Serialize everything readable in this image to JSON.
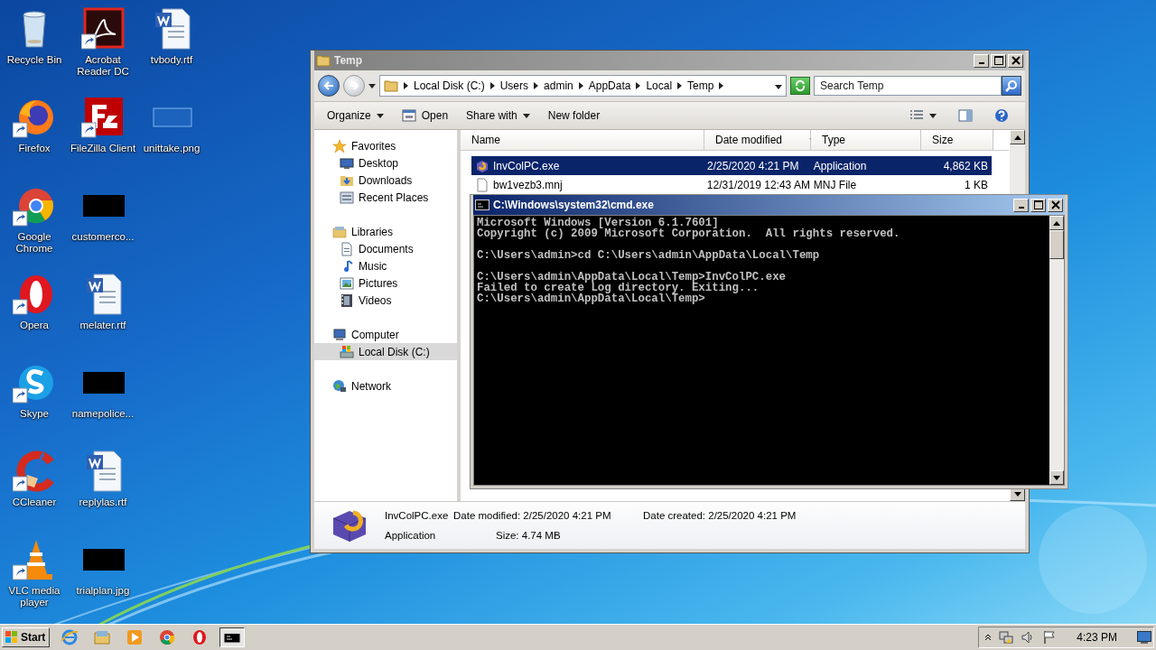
{
  "desktop": {
    "columns": [
      [
        {
          "label": "Recycle Bin",
          "kind": "recycle",
          "shortcut": false
        },
        {
          "label": "Firefox",
          "kind": "firefox",
          "shortcut": true
        },
        {
          "label": "Google Chrome",
          "kind": "chrome",
          "shortcut": true
        },
        {
          "label": "Opera",
          "kind": "opera",
          "shortcut": true
        },
        {
          "label": "Skype",
          "kind": "skype",
          "shortcut": true
        },
        {
          "label": "CCleaner",
          "kind": "ccleaner",
          "shortcut": true
        },
        {
          "label": "VLC media player",
          "kind": "vlc",
          "shortcut": true
        }
      ],
      [
        {
          "label": "Acrobat Reader DC",
          "kind": "acrobat",
          "shortcut": true
        },
        {
          "label": "FileZilla Client",
          "kind": "filezilla",
          "shortcut": true
        },
        {
          "label": "customerco...",
          "kind": "thumb",
          "shortcut": false
        },
        {
          "label": "melater.rtf",
          "kind": "word",
          "shortcut": false
        },
        {
          "label": "namepolice...",
          "kind": "thumb",
          "shortcut": false
        },
        {
          "label": "replylas.rtf",
          "kind": "word",
          "shortcut": false
        },
        {
          "label": "trialplan.jpg",
          "kind": "thumb",
          "shortcut": false
        }
      ],
      [
        {
          "label": "tvbody.rtf",
          "kind": "word",
          "shortcut": false
        },
        {
          "label": "unittake.png",
          "kind": "blank",
          "shortcut": false
        }
      ]
    ]
  },
  "explorer": {
    "title": "Temp",
    "active": false,
    "breadcrumb": [
      "Local Disk (C:)",
      "Users",
      "admin",
      "AppData",
      "Local",
      "Temp"
    ],
    "search": {
      "placeholder": "Search Temp"
    },
    "toolbar": [
      {
        "label": "Organize",
        "kind": "menu"
      },
      {
        "label": "Open",
        "kind": "open"
      },
      {
        "label": "Share with",
        "kind": "menu"
      },
      {
        "label": "New folder",
        "kind": "plain"
      }
    ],
    "nav": [
      {
        "label": "Favorites",
        "kind": "star",
        "selected": false,
        "children": [
          {
            "label": "Desktop",
            "kind": "desktop",
            "selected": false
          },
          {
            "label": "Downloads",
            "kind": "downloads",
            "selected": false
          },
          {
            "label": "Recent Places",
            "kind": "recent",
            "selected": false
          }
        ]
      },
      {
        "label": "Libraries",
        "kind": "library",
        "selected": false,
        "children": [
          {
            "label": "Documents",
            "kind": "documents",
            "selected": false
          },
          {
            "label": "Music",
            "kind": "music",
            "selected": false
          },
          {
            "label": "Pictures",
            "kind": "pictures",
            "selected": false
          },
          {
            "label": "Videos",
            "kind": "videos",
            "selected": false
          }
        ]
      },
      {
        "label": "Computer",
        "kind": "computer",
        "selected": false,
        "children": [
          {
            "label": "Local Disk (C:)",
            "kind": "drive",
            "selected": true
          }
        ]
      },
      {
        "label": "Network",
        "kind": "network",
        "selected": false
      }
    ],
    "columns": [
      {
        "label": "Name",
        "sorted": false
      },
      {
        "label": "Date modified",
        "sorted": true
      },
      {
        "label": "Type",
        "sorted": false
      },
      {
        "label": "Size",
        "sorted": false
      }
    ],
    "rows": [
      {
        "name": "InvColPC.exe",
        "kind": "exe",
        "date": "2/25/2020 4:21 PM",
        "type": "Application",
        "size": "4,862 KB",
        "selected": true
      },
      {
        "name": "bw1vezb3.mnj",
        "kind": "file",
        "date": "12/31/2019 12:43 AM",
        "type": "MNJ File",
        "size": "1 KB",
        "selected": false
      }
    ],
    "details": {
      "name": "InvColPC.exe",
      "type": "Application",
      "modified": "Date modified: 2/25/2020 4:21 PM",
      "created": "Date created: 2/25/2020 4:21 PM",
      "size": "Size: 4.74 MB"
    }
  },
  "cmd": {
    "title": "C:\\Windows\\system32\\cmd.exe",
    "active": true,
    "blocks": [
      [
        "Microsoft Windows [Version 6.1.7601]",
        "Copyright (c) 2009 Microsoft Corporation.  All rights reserved."
      ],
      [
        "C:\\Users\\admin>cd C:\\Users\\admin\\AppData\\Local\\Temp"
      ],
      [
        "C:\\Users\\admin\\AppData\\Local\\Temp>InvColPC.exe",
        "Failed to create Log directory. Exiting...",
        "C:\\Users\\admin\\AppData\\Local\\Temp>"
      ]
    ]
  },
  "taskbar": {
    "start": "Start",
    "items": [
      {
        "kind": "ie",
        "active": false
      },
      {
        "kind": "explorer",
        "active": false
      },
      {
        "kind": "media",
        "active": false
      },
      {
        "kind": "chrome",
        "active": false
      },
      {
        "kind": "opera",
        "active": false
      },
      {
        "kind": "cmd",
        "active": true
      }
    ],
    "clock": "4:23 PM"
  }
}
